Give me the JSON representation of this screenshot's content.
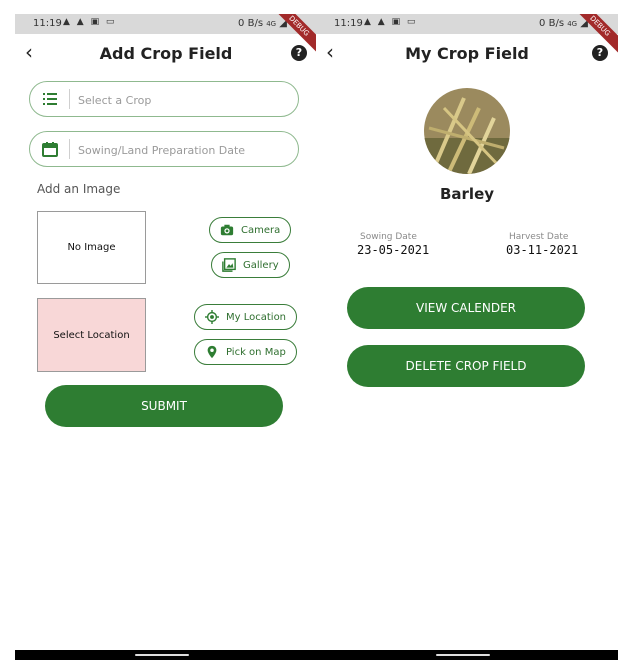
{
  "status_bar": {
    "time": "11:19",
    "net_speed": "0 B/s",
    "network": "4G",
    "debug_banner": "DEBUG"
  },
  "add_screen": {
    "title": "Add Crop Field",
    "crop_field": {
      "placeholder": "Select a Crop",
      "value": "",
      "icon": "list-icon"
    },
    "date_field": {
      "placeholder": "Sowing/Land Preparation Date",
      "value": "",
      "icon": "calendar-icon"
    },
    "add_image_label": "Add an Image",
    "no_image_text": "No Image",
    "camera_label": "Camera",
    "gallery_label": "Gallery",
    "select_location_text": "Select Location",
    "my_location_label": "My Location",
    "pick_on_map_label": "Pick on Map",
    "submit_label": "SUBMIT"
  },
  "detail_screen": {
    "title": "My Crop Field",
    "crop_name": "Barley",
    "sowing_label": "Sowing Date",
    "sowing_date": "23-05-2021",
    "harvest_label": "Harvest Date",
    "harvest_date": "03-11-2021",
    "view_calendar_label": "VIEW CALENDER",
    "delete_label": "DELETE CROP FIELD"
  },
  "colors": {
    "primary_green": "#2e7d32",
    "field_border": "#8fb98f",
    "location_box": "#f8d7d7",
    "debug_ribbon": "#a22a2a"
  }
}
